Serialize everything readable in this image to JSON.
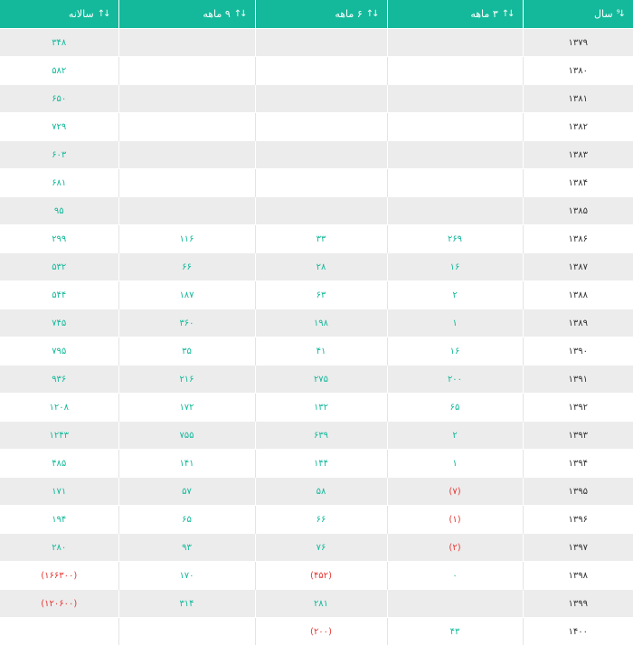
{
  "table": {
    "headers": {
      "year": "سال",
      "q3": "۳ ماهه",
      "q6": "۶ ماهه",
      "q9": "۹ ماهه",
      "annual": "سالانه"
    },
    "rows": [
      {
        "year": "۱۳۷۹",
        "q3": "",
        "q6": "",
        "q9": "",
        "annual": "۳۴۸"
      },
      {
        "year": "۱۳۸۰",
        "q3": "",
        "q6": "",
        "q9": "",
        "annual": "۵۸۲"
      },
      {
        "year": "۱۳۸۱",
        "q3": "",
        "q6": "",
        "q9": "",
        "annual": "۶۵۰"
      },
      {
        "year": "۱۳۸۲",
        "q3": "",
        "q6": "",
        "q9": "",
        "annual": "۷۲۹"
      },
      {
        "year": "۱۳۸۳",
        "q3": "",
        "q6": "",
        "q9": "",
        "annual": "۶۰۳"
      },
      {
        "year": "۱۳۸۴",
        "q3": "",
        "q6": "",
        "q9": "",
        "annual": "۶۸۱"
      },
      {
        "year": "۱۳۸۵",
        "q3": "",
        "q6": "",
        "q9": "",
        "annual": "۹۵"
      },
      {
        "year": "۱۳۸۶",
        "q3": "۲۶۹",
        "q6": "۳۳",
        "q9": "۱۱۶",
        "annual": "۲۹۹"
      },
      {
        "year": "۱۳۸۷",
        "q3": "۱۶",
        "q6": "۲۸",
        "q9": "۶۶",
        "annual": "۵۳۲"
      },
      {
        "year": "۱۳۸۸",
        "q3": "۲",
        "q6": "۶۳",
        "q9": "۱۸۷",
        "annual": "۵۴۴"
      },
      {
        "year": "۱۳۸۹",
        "q3": "۱",
        "q6": "۱۹۸",
        "q9": "۳۶۰",
        "annual": "۷۴۵"
      },
      {
        "year": "۱۳۹۰",
        "q3": "۱۶",
        "q6": "۴۱",
        "q9": "۳۵",
        "annual": "۷۹۵"
      },
      {
        "year": "۱۳۹۱",
        "q3": "۲۰۰",
        "q6": "۲۷۵",
        "q9": "۲۱۶",
        "annual": "۹۳۶"
      },
      {
        "year": "۱۳۹۲",
        "q3": "۶۵",
        "q6": "۱۳۲",
        "q9": "۱۷۲",
        "annual": "۱۲۰۸"
      },
      {
        "year": "۱۳۹۳",
        "q3": "۲",
        "q6": "۶۳۹",
        "q9": "۷۵۵",
        "annual": "۱۲۴۳"
      },
      {
        "year": "۱۳۹۴",
        "q3": "۱",
        "q6": "۱۴۴",
        "q9": "۱۴۱",
        "annual": "۴۸۵"
      },
      {
        "year": "۱۳۹۵",
        "q3": "(۷)",
        "q6": "۵۸",
        "q9": "۵۷",
        "annual": "۱۷۱"
      },
      {
        "year": "۱۳۹۶",
        "q3": "(۱)",
        "q6": "۶۶",
        "q9": "۶۵",
        "annual": "۱۹۴"
      },
      {
        "year": "۱۳۹۷",
        "q3": "(۲)",
        "q6": "۷۶",
        "q9": "۹۳",
        "annual": "۲۸۰"
      },
      {
        "year": "۱۳۹۸",
        "q3": "۰",
        "q6": "(۴۵۲)",
        "q9": "۱۷۰",
        "annual": "(۱۶۶۳۰۰)"
      },
      {
        "year": "۱۳۹۹",
        "q3": "",
        "q6": "۲۸۱",
        "q9": "۳۱۴",
        "annual": "(۱۲۰۶۰۰)"
      },
      {
        "year": "۱۴۰۰",
        "q3": "۴۳",
        "q6": "(۲۰۰)",
        "q9": "",
        "annual": ""
      }
    ]
  },
  "colors": {
    "header_bg": "#14b99b",
    "value_text": "#14b99b",
    "negative_text": "#e53935",
    "year_text": "#333333",
    "stripe_bg": "#ececec"
  },
  "icons": {
    "year_sort": "sort-numeric-desc-icon",
    "column_sort": "sort-arrows-icon"
  }
}
